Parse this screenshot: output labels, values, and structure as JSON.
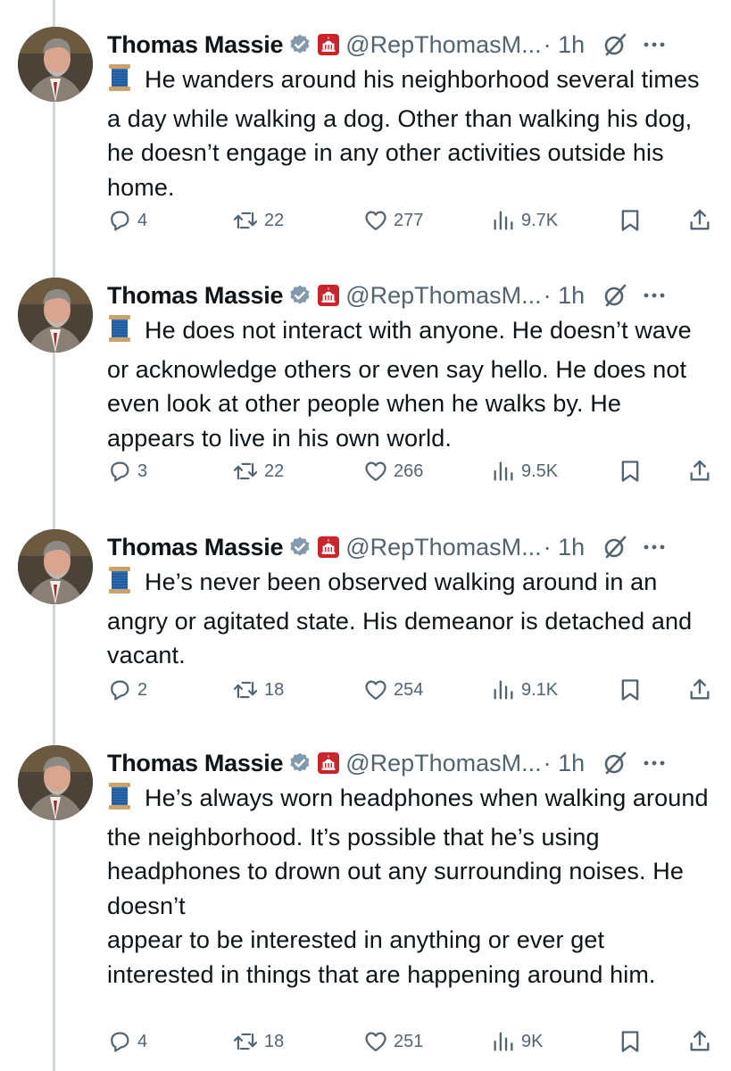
{
  "tweets": [
    {
      "name": "Thomas Massie",
      "handle": "@RepThomasM...",
      "time": "· 1h",
      "text_lines": [
        "He wanders around his neighborhood several times a day while walking a dog. Other than walking his dog, he doesn’t engage in any other activities outside his home."
      ],
      "replies": "4",
      "retweets": "22",
      "likes": "277",
      "views": "9.7K"
    },
    {
      "name": "Thomas Massie",
      "handle": "@RepThomasM...",
      "time": "· 1h",
      "text_lines": [
        "He does not interact with anyone. He doesn’t wave or acknowledge others or even say hello. He does not even look at other people when he walks by. He appears to live in his own world."
      ],
      "replies": "3",
      "retweets": "22",
      "likes": "266",
      "views": "9.5K"
    },
    {
      "name": "Thomas Massie",
      "handle": "@RepThomasM...",
      "time": "· 1h",
      "text_lines": [
        "He’s never been observed walking around in an angry or agitated state. His demeanor is detached and vacant."
      ],
      "replies": "2",
      "retweets": "18",
      "likes": "254",
      "views": "9.1K"
    },
    {
      "name": "Thomas Massie",
      "handle": "@RepThomasM...",
      "time": "· 1h",
      "text_lines": [
        "He’s always worn headphones when walking around the neighborhood. It’s possible that he’s using headphones to drown out any surrounding noises. He doesn’t",
        "appear to be interested in anything or ever get interested in things that are happening around him."
      ],
      "replies": "4",
      "retweets": "18",
      "likes": "251",
      "views": "9K"
    }
  ],
  "icons": {
    "lead": "spool-of-thread-icon",
    "verified": "verified-badge-icon",
    "affiliation": "capitol-affiliation-icon",
    "grok": "grok-icon",
    "more": "more-icon",
    "reply": "reply-icon",
    "retweet": "retweet-icon",
    "like": "heart-icon",
    "views": "views-icon",
    "bookmark": "bookmark-icon",
    "share": "share-icon"
  },
  "colors": {
    "text": "#0f1419",
    "secondary": "#536471",
    "verified": "#829aab",
    "affiliation": "#c8252c",
    "thread_line": "#cfd9de"
  }
}
